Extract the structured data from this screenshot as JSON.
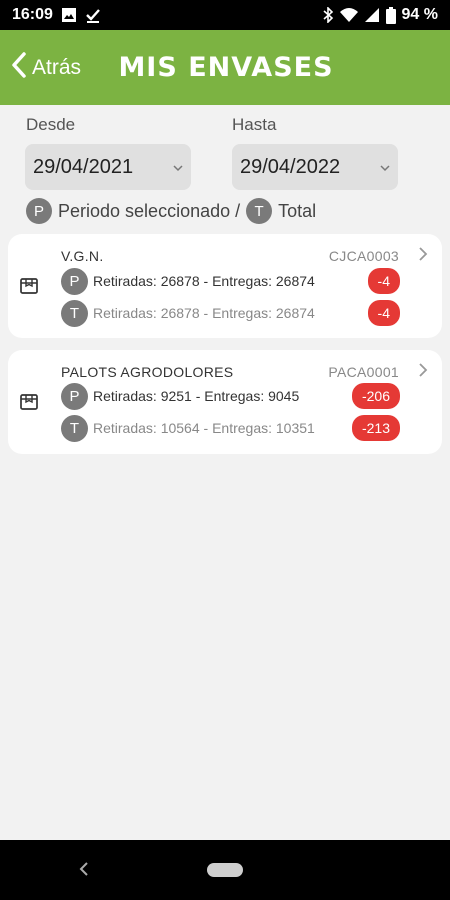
{
  "status_bar": {
    "time": "16:09",
    "battery": "94 %",
    "left_icons": [
      "image-icon",
      "download-done-icon"
    ],
    "right_icons": [
      "bluetooth-icon",
      "wifi-icon",
      "signal-icon",
      "battery-icon"
    ]
  },
  "header": {
    "back_label": "Atrás",
    "title": "MIS ENVASES",
    "color": "#7cb342"
  },
  "filters": {
    "from_label": "Desde",
    "from_value": "29/04/2021",
    "to_label": "Hasta",
    "to_value": "29/04/2022"
  },
  "legend": {
    "period_letter": "P",
    "period_label": "Periodo seleccionado /",
    "total_letter": "T",
    "total_label": "Total"
  },
  "items": [
    {
      "name": "V.G.N.",
      "code": "CJCA0003",
      "period": {
        "letter": "P",
        "text": "Retiradas: 26878 - Entregas: 26874",
        "balance": "-4"
      },
      "total": {
        "letter": "T",
        "text": "Retiradas: 26878 - Entregas: 26874",
        "balance": "-4"
      }
    },
    {
      "name": "PALOTS AGRODOLORES",
      "code": "PACA0001",
      "period": {
        "letter": "P",
        "text": "Retiradas: 9251 - Entregas: 9045",
        "balance": "-206"
      },
      "total": {
        "letter": "T",
        "text": "Retiradas: 10564 - Entregas: 10351",
        "balance": "-213"
      }
    }
  ],
  "colors": {
    "badge": "#e53935",
    "circle": "#7a7a7a",
    "background": "#f2f2f2"
  }
}
